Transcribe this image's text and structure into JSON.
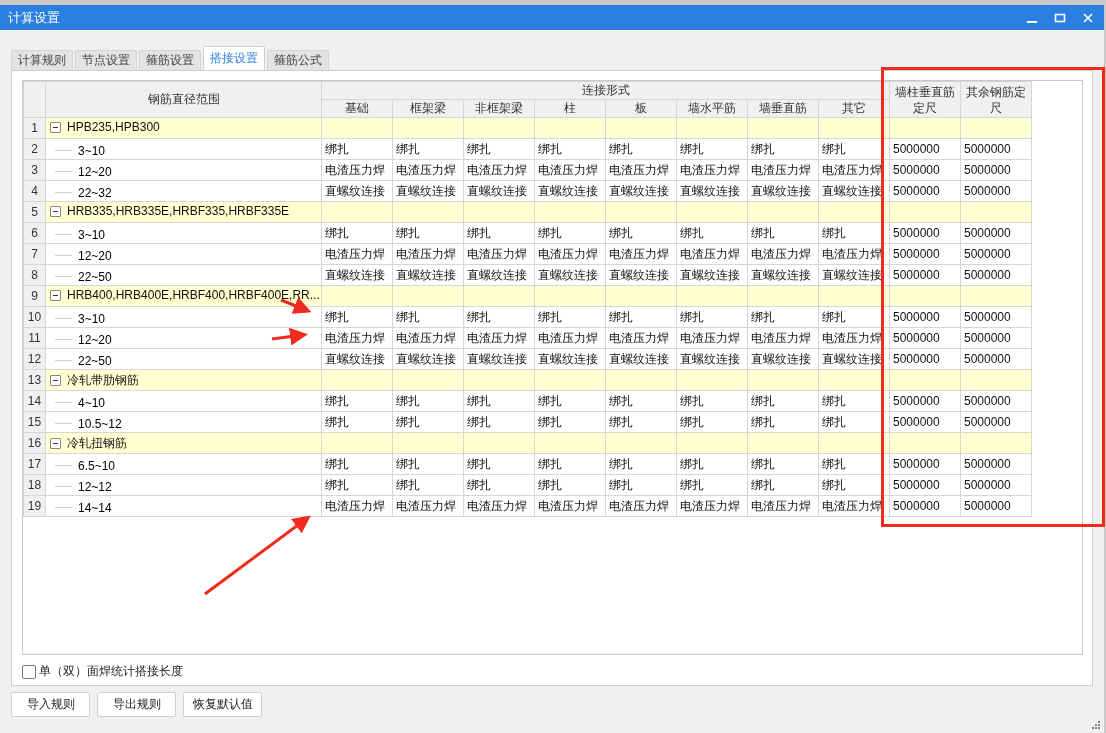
{
  "window": {
    "title": "计算设置"
  },
  "tabs": [
    {
      "label": "计算规则",
      "selected": false
    },
    {
      "label": "节点设置",
      "selected": false
    },
    {
      "label": "箍筋设置",
      "selected": false
    },
    {
      "label": "搭接设置",
      "selected": true
    },
    {
      "label": "箍筋公式",
      "selected": false
    }
  ],
  "grid": {
    "name_header": "钢筋直径范围",
    "group_header": "连接形式",
    "connection_columns": [
      "基础",
      "框架梁",
      "非框架梁",
      "柱",
      "板",
      "墙水平筋",
      "墙垂直筋",
      "其它"
    ],
    "length_columns": [
      "墙柱垂直筋定尺",
      "其余钢筋定尺"
    ],
    "groups": [
      {
        "no": "1",
        "label": "HPB235,HPB300",
        "expanded": true,
        "children": [
          {
            "no": "2",
            "range": "3~10",
            "connections": [
              "绑扎",
              "绑扎",
              "绑扎",
              "绑扎",
              "绑扎",
              "绑扎",
              "绑扎",
              "绑扎"
            ],
            "lengths": [
              "5000000",
              "5000000"
            ]
          },
          {
            "no": "3",
            "range": "12~20",
            "connections": [
              "电渣压力焊",
              "电渣压力焊",
              "电渣压力焊",
              "电渣压力焊",
              "电渣压力焊",
              "电渣压力焊",
              "电渣压力焊",
              "电渣压力焊"
            ],
            "lengths": [
              "5000000",
              "5000000"
            ]
          },
          {
            "no": "4",
            "range": "22~32",
            "connections": [
              "直螺纹连接",
              "直螺纹连接",
              "直螺纹连接",
              "直螺纹连接",
              "直螺纹连接",
              "直螺纹连接",
              "直螺纹连接",
              "直螺纹连接"
            ],
            "lengths": [
              "5000000",
              "5000000"
            ]
          }
        ]
      },
      {
        "no": "5",
        "label": "HRB335,HRB335E,HRBF335,HRBF335E",
        "expanded": true,
        "children": [
          {
            "no": "6",
            "range": "3~10",
            "connections": [
              "绑扎",
              "绑扎",
              "绑扎",
              "绑扎",
              "绑扎",
              "绑扎",
              "绑扎",
              "绑扎"
            ],
            "lengths": [
              "5000000",
              "5000000"
            ]
          },
          {
            "no": "7",
            "range": "12~20",
            "connections": [
              "电渣压力焊",
              "电渣压力焊",
              "电渣压力焊",
              "电渣压力焊",
              "电渣压力焊",
              "电渣压力焊",
              "电渣压力焊",
              "电渣压力焊"
            ],
            "lengths": [
              "5000000",
              "5000000"
            ]
          },
          {
            "no": "8",
            "range": "22~50",
            "connections": [
              "直螺纹连接",
              "直螺纹连接",
              "直螺纹连接",
              "直螺纹连接",
              "直螺纹连接",
              "直螺纹连接",
              "直螺纹连接",
              "直螺纹连接"
            ],
            "lengths": [
              "5000000",
              "5000000"
            ]
          }
        ]
      },
      {
        "no": "9",
        "label": "HRB400,HRB400E,HRBF400,HRBF400E,RR...",
        "expanded": true,
        "children": [
          {
            "no": "10",
            "range": "3~10",
            "connections": [
              "绑扎",
              "绑扎",
              "绑扎",
              "绑扎",
              "绑扎",
              "绑扎",
              "绑扎",
              "绑扎"
            ],
            "lengths": [
              "5000000",
              "5000000"
            ]
          },
          {
            "no": "11",
            "range": "12~20",
            "connections": [
              "电渣压力焊",
              "电渣压力焊",
              "电渣压力焊",
              "电渣压力焊",
              "电渣压力焊",
              "电渣压力焊",
              "电渣压力焊",
              "电渣压力焊"
            ],
            "lengths": [
              "5000000",
              "5000000"
            ]
          },
          {
            "no": "12",
            "range": "22~50",
            "connections": [
              "直螺纹连接",
              "直螺纹连接",
              "直螺纹连接",
              "直螺纹连接",
              "直螺纹连接",
              "直螺纹连接",
              "直螺纹连接",
              "直螺纹连接"
            ],
            "lengths": [
              "5000000",
              "5000000"
            ]
          }
        ]
      },
      {
        "no": "13",
        "label": "冷轧带肋钢筋",
        "expanded": true,
        "children": [
          {
            "no": "14",
            "range": "4~10",
            "connections": [
              "绑扎",
              "绑扎",
              "绑扎",
              "绑扎",
              "绑扎",
              "绑扎",
              "绑扎",
              "绑扎"
            ],
            "lengths": [
              "5000000",
              "5000000"
            ]
          },
          {
            "no": "15",
            "range": "10.5~12",
            "connections": [
              "绑扎",
              "绑扎",
              "绑扎",
              "绑扎",
              "绑扎",
              "绑扎",
              "绑扎",
              "绑扎"
            ],
            "lengths": [
              "5000000",
              "5000000"
            ]
          }
        ]
      },
      {
        "no": "16",
        "label": "冷轧扭钢筋",
        "expanded": true,
        "children": [
          {
            "no": "17",
            "range": "6.5~10",
            "connections": [
              "绑扎",
              "绑扎",
              "绑扎",
              "绑扎",
              "绑扎",
              "绑扎",
              "绑扎",
              "绑扎"
            ],
            "lengths": [
              "5000000",
              "5000000"
            ]
          },
          {
            "no": "18",
            "range": "12~12",
            "connections": [
              "绑扎",
              "绑扎",
              "绑扎",
              "绑扎",
              "绑扎",
              "绑扎",
              "绑扎",
              "绑扎"
            ],
            "lengths": [
              "5000000",
              "5000000"
            ]
          },
          {
            "no": "19",
            "range": "14~14",
            "connections": [
              "电渣压力焊",
              "电渣压力焊",
              "电渣压力焊",
              "电渣压力焊",
              "电渣压力焊",
              "电渣压力焊",
              "电渣压力焊",
              "电渣压力焊"
            ],
            "lengths": [
              "5000000",
              "5000000"
            ]
          }
        ]
      }
    ]
  },
  "checkbox": {
    "label": "单（双）面焊统计搭接长度",
    "checked": false
  },
  "buttons": [
    "导入规则",
    "导出规则",
    "恢复默认值"
  ]
}
